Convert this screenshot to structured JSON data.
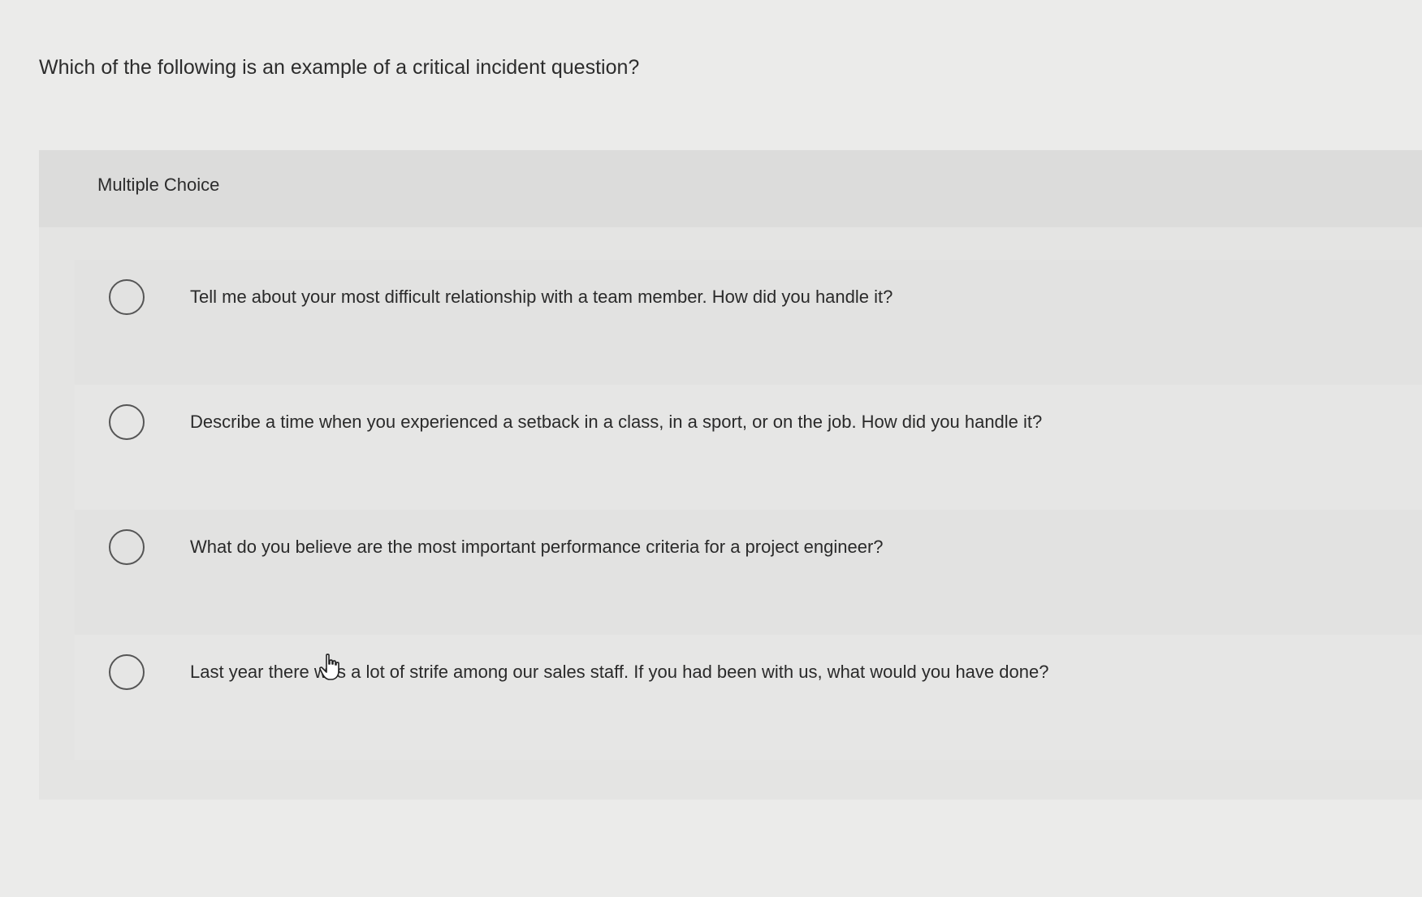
{
  "question": {
    "text": "Which of the following is an example of a critical incident question?"
  },
  "panel": {
    "type_label": "Multiple Choice"
  },
  "options": [
    {
      "text": "Tell me about your most difficult relationship with a team member. How did you handle it?",
      "selected": false
    },
    {
      "text": "Describe a time when you experienced a setback in a class, in a sport, or on the job. How did you handle it?",
      "selected": false
    },
    {
      "text": "What do you believe are the most important performance criteria for a project engineer?",
      "selected": false
    },
    {
      "text": "Last year there was a lot of strife among our sales staff. If you had been with us, what would you have done?",
      "selected": false
    }
  ],
  "icons": {
    "radio": "radio-unchecked-icon",
    "cursor": "hand-pointer-icon"
  }
}
